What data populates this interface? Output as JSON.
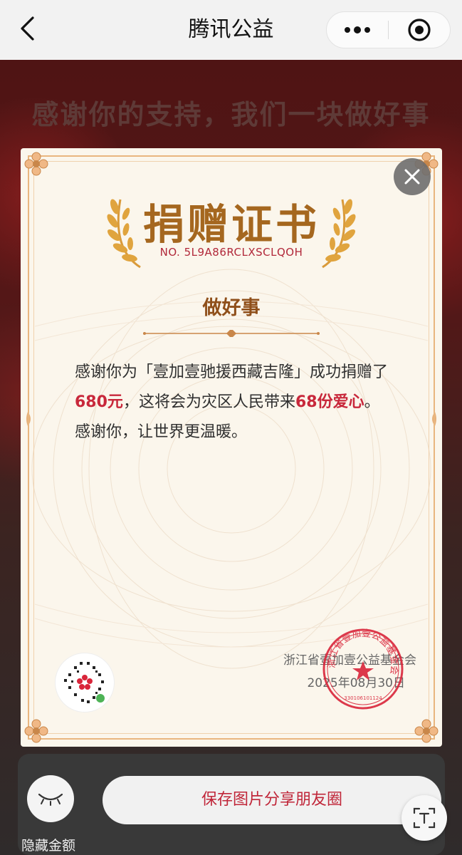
{
  "nav": {
    "title": "腾讯公益",
    "back_icon": "chevron-left-icon",
    "more_icon": "more-dots-icon",
    "close_icon": "target-circle-icon"
  },
  "banner": {
    "text": "感谢你的支持，我们一块做好事"
  },
  "certificate": {
    "title": "捐赠证书",
    "number": "NO. 5L9A86RCLXSCLQOH",
    "donor_name": "做好事",
    "body_part1": "感谢你为「壹加壹驰援西藏吉隆」成功捐赠了",
    "amount": "680元",
    "body_part2": "，这将会为灾区人民带来",
    "love_count": "68份爱心",
    "body_part3": "。感谢你，让世界更温暖。",
    "foundation": "浙江省壹加壹公益基金会",
    "date": "2025年08月30日",
    "seal_text": "浙江省壹加壹公益基金会",
    "seal_number": "330106101124",
    "close_icon": "close-x-icon"
  },
  "bottom": {
    "hide_label": "隐藏金额",
    "save_button": "保存图片分享朋友圈",
    "eye_icon": "eye-closed-icon",
    "text_tool_icon": "text-recognition-icon"
  },
  "colors": {
    "accent_red": "#c8283b",
    "gold": "#a5671f",
    "frame": "#e9b67f"
  }
}
